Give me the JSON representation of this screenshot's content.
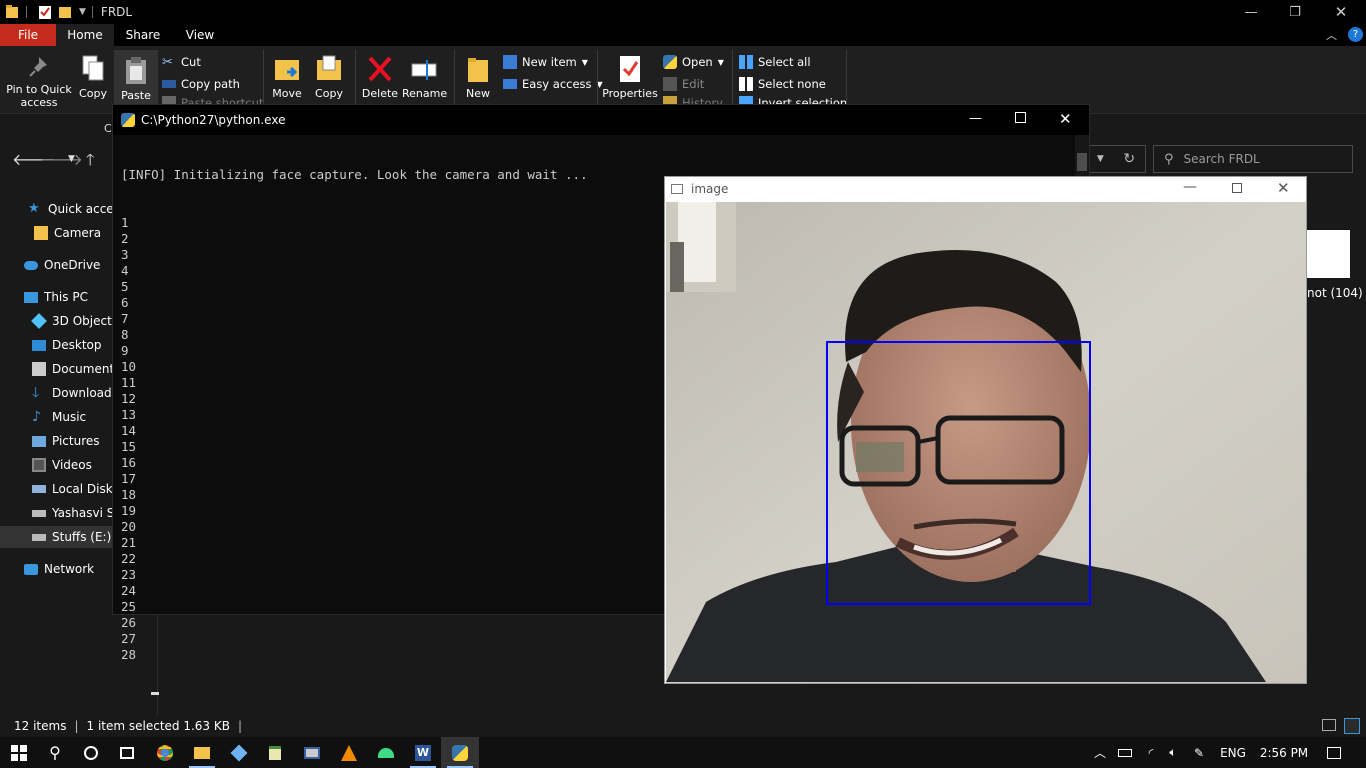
{
  "explorer": {
    "title": "FRDL",
    "tabs": {
      "file": "File",
      "home": "Home",
      "share": "Share",
      "view": "View"
    },
    "ribbon": {
      "pin_quick_access_line1": "Pin to Quick",
      "pin_quick_access_line2": "access",
      "copy": "Copy",
      "paste": "Paste",
      "cut": "Cut",
      "copy_path": "Copy path",
      "paste_shortcut_partial": "Paste shortcut",
      "move": "Move",
      "copy_to": "Copy",
      "delete": "Delete",
      "rename": "Rename",
      "new": "New",
      "new_item": "New item",
      "easy_access": "Easy access",
      "properties": "Properties",
      "open": "Open",
      "edit": "Edit",
      "history_partial": "History",
      "select_all": "Select all",
      "select_none": "Select none",
      "invert_selection_partial": "Invert selection",
      "clip_partial": "C"
    },
    "search_placeholder": "Search FRDL",
    "nav_items": {
      "quick_access": "Quick access",
      "camera": "Camera",
      "onedrive": "OneDrive",
      "this_pc": "This PC",
      "objects3d": "3D Objects",
      "desktop": "Desktop",
      "documents": "Documents",
      "downloads": "Downloads",
      "music": "Music",
      "pictures": "Pictures",
      "videos": "Videos",
      "local_disk": "Local Disk (",
      "yashasvi": "Yashasvi Sh",
      "stuffs": "Stuffs (E:)",
      "network": "Network"
    },
    "file_label_partial": "not (104)",
    "status": {
      "items": "12 items",
      "selected": "1 item selected  1.63 KB"
    }
  },
  "console": {
    "title": "C:\\Python27\\python.exe",
    "info_line": "[INFO] Initializing face capture. Look the camera and wait ...",
    "counter_lines": [
      "1",
      "2",
      "3",
      "4",
      "5",
      "6",
      "7",
      "8",
      "9",
      "10",
      "11",
      "12",
      "13",
      "14",
      "15",
      "16",
      "17",
      "18",
      "19",
      "20",
      "21",
      "22",
      "23",
      "24",
      "25",
      "26",
      "27",
      "28"
    ]
  },
  "image_window": {
    "title": "image",
    "detection_box_color": "#0000ff"
  },
  "taskbar": {
    "language": "ENG",
    "time": "2:56 PM"
  },
  "colors": {
    "file_tab": "#c42b1c",
    "accent_blue": "#1e90ff"
  }
}
